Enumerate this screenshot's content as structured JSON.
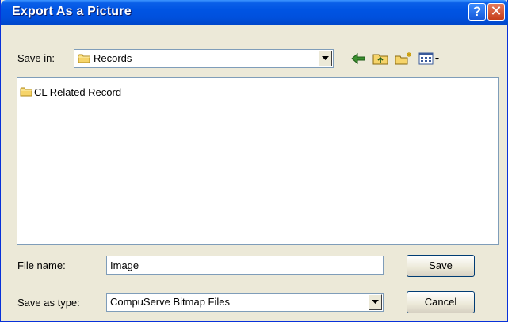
{
  "window": {
    "title": "Export As a Picture",
    "help_icon": "question-mark-icon",
    "close_icon": "close-x-icon"
  },
  "save_in": {
    "label": "Save in:",
    "value": "Records",
    "icon": "folder-icon"
  },
  "toolbar": {
    "back_icon": "back-arrow-icon",
    "up_folder_icon": "up-one-level-icon",
    "new_folder_icon": "create-new-folder-icon",
    "view_menu_icon": "view-menu-icon"
  },
  "files": [
    {
      "name": "CL Related Record",
      "icon": "folder-icon"
    }
  ],
  "file_name": {
    "label": "File name:",
    "value": "Image"
  },
  "save_as_type": {
    "label": "Save as type:",
    "value": "CompuServe Bitmap Files"
  },
  "buttons": {
    "save": "Save",
    "cancel": "Cancel"
  },
  "colors": {
    "titlebar": "#0054e3",
    "dialog_bg": "#ece9d8",
    "close_button": "#c63d1a"
  }
}
